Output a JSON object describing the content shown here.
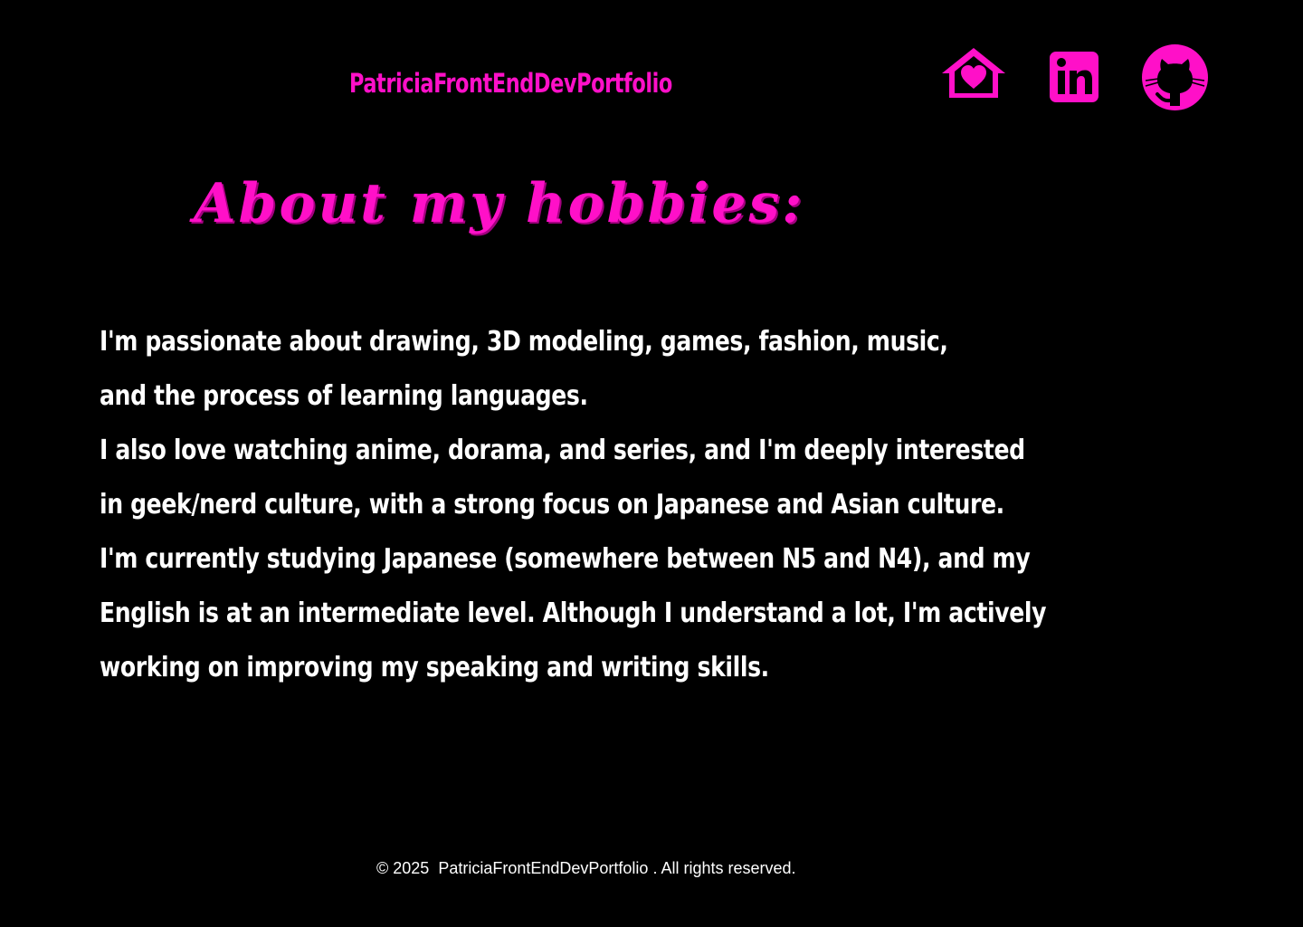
{
  "header": {
    "site_title": "PatriciaFrontEndDevPortfolio",
    "icons": [
      "home-heart-icon",
      "linkedin-icon",
      "github-icon"
    ]
  },
  "main": {
    "heading": "About my hobbies:",
    "bio_lines": [
      "I'm passionate about drawing, 3D modeling, games, fashion, music,",
      "and the process of learning languages.",
      "I also love watching anime, dorama, and series, and I'm deeply interested",
      "in geek/nerd culture, with a strong focus on Japanese and Asian culture.",
      "I'm currently studying Japanese (somewhere between N5 and N4), and my",
      "English is at an intermediate level. Although I understand a lot, I'm actively",
      "working on improving my speaking and writing skills."
    ]
  },
  "footer": {
    "copyright": "© 2025",
    "site_name": "PatriciaFrontEndDevPortfolio",
    "rights": ". All rights reserved."
  },
  "colors": {
    "background": "#000000",
    "accent": "#ff10c8",
    "text": "#ffffff"
  }
}
